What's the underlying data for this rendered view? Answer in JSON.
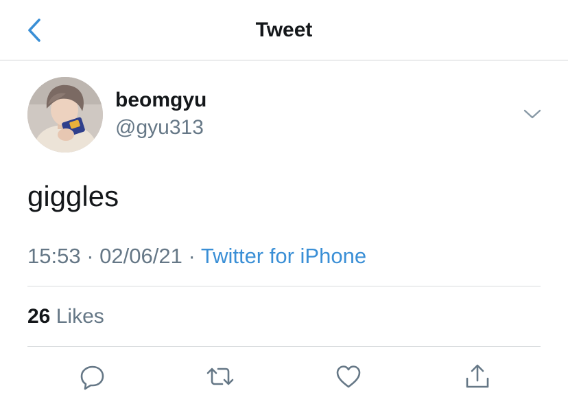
{
  "nav": {
    "title": "Tweet",
    "back_icon": "chevron-left-icon",
    "accent_color": "#3a8fd6"
  },
  "tweet": {
    "author": {
      "display_name": "beomgyu",
      "handle": "@gyu313"
    },
    "text": "giggles",
    "time": "15:53",
    "separator": "·",
    "date": "02/06/21",
    "source": "Twitter for iPhone"
  },
  "stats": {
    "likes_count": "26",
    "likes_label": "Likes"
  },
  "actions": [
    {
      "icon": "reply-icon"
    },
    {
      "icon": "retweet-icon"
    },
    {
      "icon": "like-icon"
    },
    {
      "icon": "share-icon"
    }
  ]
}
